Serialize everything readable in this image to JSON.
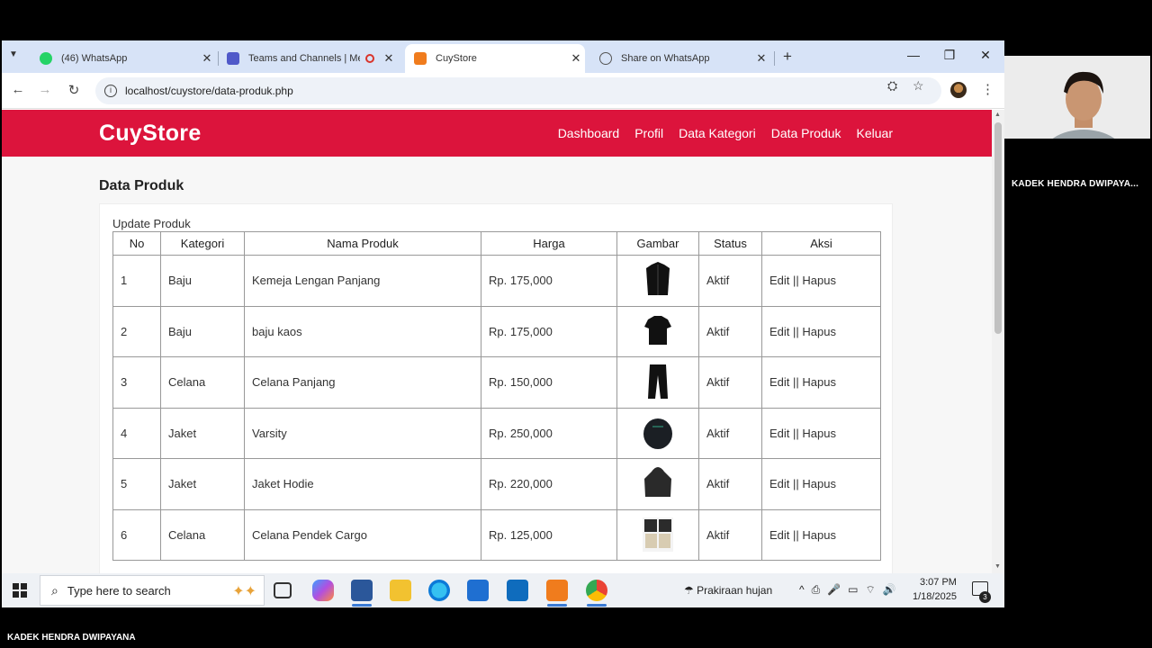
{
  "browser": {
    "tabs": [
      {
        "title": "(46) WhatsApp",
        "icon": "whatsapp-icon",
        "color": "#25d366"
      },
      {
        "title": "Teams and Channels | Meet",
        "icon": "teams-icon",
        "color": "#5059c9"
      },
      {
        "title": "CuyStore",
        "icon": "xampp-icon",
        "color": "#f07c1d"
      },
      {
        "title": "Share on WhatsApp",
        "icon": "globe-icon",
        "color": "#555555"
      }
    ],
    "url": "localhost/cuystore/data-produk.php"
  },
  "site": {
    "brand": "CuyStore",
    "nav": [
      "Dashboard",
      "Profil",
      "Data Kategori",
      "Data Produk",
      "Keluar"
    ],
    "header_color": "#dc143c"
  },
  "page": {
    "title": "Data Produk",
    "card_title": "Update Produk",
    "table": {
      "headers": [
        "No",
        "Kategori",
        "Nama Produk",
        "Harga",
        "Gambar",
        "Status",
        "Aksi"
      ],
      "rows": [
        {
          "no": "1",
          "kategori": "Baju",
          "nama": "Kemeja Lengan Panjang",
          "harga": "Rp. 175,000",
          "gambar": "shirt-image",
          "status": "Aktif",
          "aksi": "Edit || Hapus"
        },
        {
          "no": "2",
          "kategori": "Baju",
          "nama": "baju kaos",
          "harga": "Rp. 175,000",
          "gambar": "tshirt-image",
          "status": "Aktif",
          "aksi": "Edit || Hapus"
        },
        {
          "no": "3",
          "kategori": "Celana",
          "nama": "Celana Panjang",
          "harga": "Rp. 150,000",
          "gambar": "trousers-image",
          "status": "Aktif",
          "aksi": "Edit || Hapus"
        },
        {
          "no": "4",
          "kategori": "Jaket",
          "nama": "Varsity",
          "harga": "Rp. 250,000",
          "gambar": "varsity-jacket-image",
          "status": "Aktif",
          "aksi": "Edit || Hapus"
        },
        {
          "no": "5",
          "kategori": "Jaket",
          "nama": "Jaket Hodie",
          "harga": "Rp. 220,000",
          "gambar": "hoodie-image",
          "status": "Aktif",
          "aksi": "Edit || Hapus"
        },
        {
          "no": "6",
          "kategori": "Celana",
          "nama": "Celana Pendek Cargo",
          "harga": "Rp. 125,000",
          "gambar": "cargo-shorts-image",
          "status": "Aktif",
          "aksi": "Edit || Hapus"
        }
      ]
    }
  },
  "taskbar": {
    "search_placeholder": "Type here to search",
    "weather": "Prakiraan hujan",
    "time": "3:07 PM",
    "date": "1/18/2025",
    "notification_count": "3"
  },
  "meeting": {
    "participant_name": "KADEK HENDRA DWIPAYA...",
    "footer_name": "KADEK HENDRA DWIPAYANA"
  }
}
